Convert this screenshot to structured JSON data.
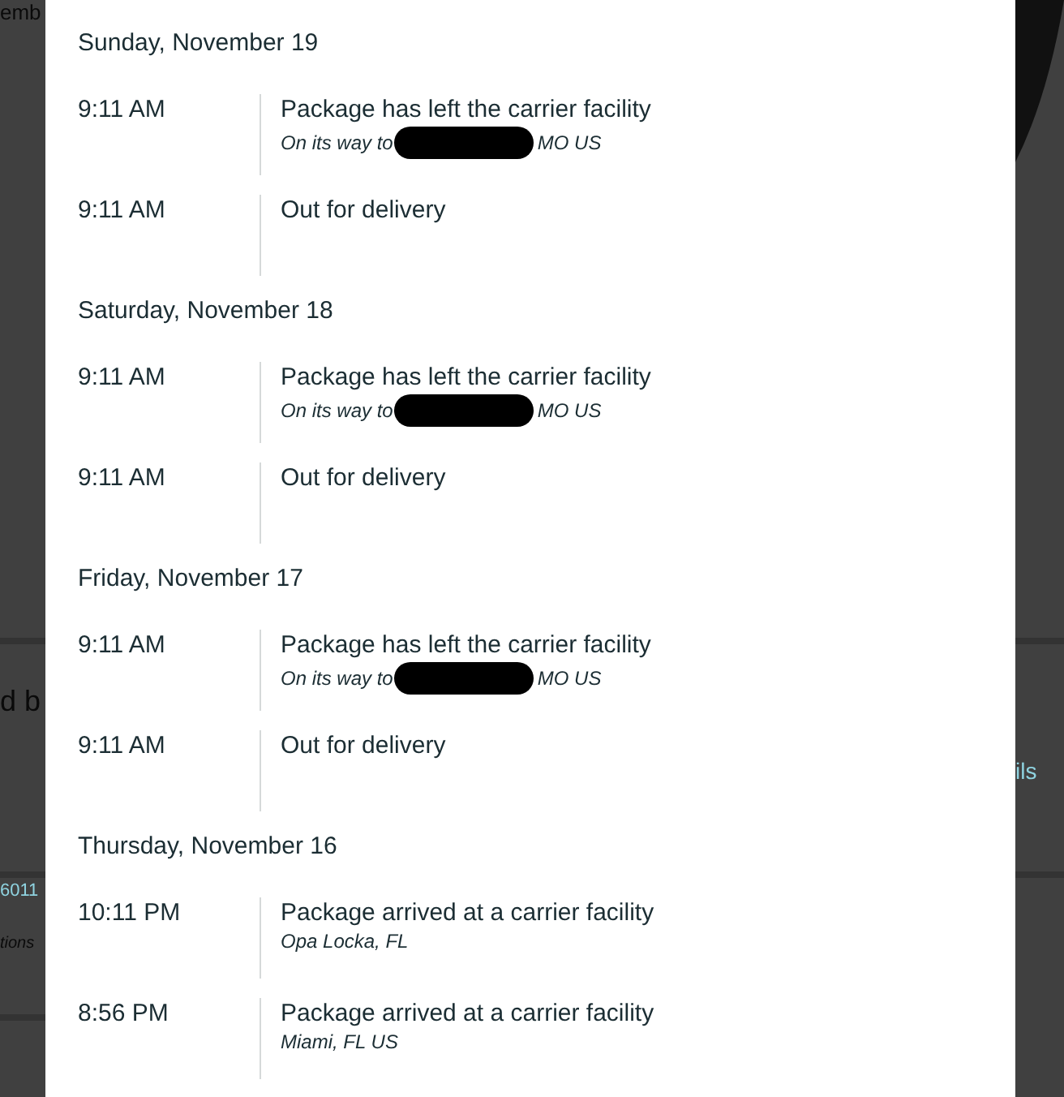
{
  "background_page": {
    "left_texts": [
      "emb",
      "d b",
      "6011",
      "tions"
    ],
    "right_texts": [
      "ils"
    ]
  },
  "tracking": {
    "days": [
      {
        "date": "Sunday, November 19",
        "events": [
          {
            "time": "9:11 AM",
            "status": "Package has left the carrier facility",
            "detail": {
              "before": "On its way to",
              "after": "MO US",
              "redacted": true
            }
          },
          {
            "time": "9:11 AM",
            "status": "Out for delivery"
          }
        ]
      },
      {
        "date": "Saturday, November 18",
        "events": [
          {
            "time": "9:11 AM",
            "status": "Package has left the carrier facility",
            "detail": {
              "before": "On its way to",
              "after": "MO US",
              "redacted": true
            }
          },
          {
            "time": "9:11 AM",
            "status": "Out for delivery"
          }
        ]
      },
      {
        "date": "Friday, November 17",
        "events": [
          {
            "time": "9:11 AM",
            "status": "Package has left the carrier facility",
            "detail": {
              "before": "On its way to",
              "after": "MO US",
              "redacted": true
            }
          },
          {
            "time": "9:11 AM",
            "status": "Out for delivery"
          }
        ]
      },
      {
        "date": "Thursday, November 16",
        "events": [
          {
            "time": "10:11 PM",
            "status": "Package arrived at a carrier facility",
            "detail": {
              "before": "Opa Locka, FL",
              "redacted": false
            }
          },
          {
            "time": "8:56 PM",
            "status": "Package arrived at a carrier facility",
            "detail": {
              "before": "Miami, FL US",
              "redacted": false
            }
          }
        ]
      }
    ]
  }
}
